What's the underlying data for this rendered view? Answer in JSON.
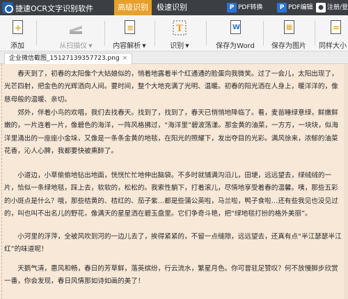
{
  "titlebar": {
    "app_title": "捷速OCR文字识别软件",
    "tabs": [
      {
        "label": "高级识别",
        "active": true
      },
      {
        "label": "极速识别",
        "active": false
      }
    ],
    "pdf_convert": "PDF转换",
    "pdf_edit": "PDF编辑",
    "user": "注册/登录"
  },
  "toolbar": {
    "add": "添加",
    "scan": "从扫描仪",
    "parse": "内容解析",
    "recognize": "识别",
    "save_word": "保存为Word",
    "save_image": "保存为图片",
    "more": "同样大小"
  },
  "doc_tab": {
    "filename": "企业微信截图_15127139357723.png",
    "close": "×"
  },
  "content": {
    "paragraphs": [
      "春天到了，初春的太阳像个大姑娘似的，悄着地露着半个红通通的脸蛋向我微笑。过了一会儿，太阳出现了，光芒四射，把金色的光辉洒向人间。要时间，整个大地充满了光明、温暖。初春的阳光洒在人身上，暖洋洋的，像慈母般的温暖、亲切。",
      "郊外，伴着小鸟的欢唱，我们去找春天。找到了，找到了，春天已悄悄地降临了。看，麦苗睡绿意绿，鲜嫩鲜嫩的，一片连着一片，像碧色的海洋，一阵风格拂过，“海洋里”碧波荡漾。那金黄的油菜，一方方，一块块，似海洋里涌出的一座座小金垛，又像是一条条金黄的地毯，在阳光的照耀下，发出夺目的光彩。满风徐来，浓郁的油菜花香，沁人心脾，我都要快被熏醉了。",
      "小道边，小草偷偷地钻出地面，恍恍忙忙地伸出脑袋。不多时就铺满沟沿儿，田埂，远远望去，绿绒绒的一片，恰似一条绿地毯，踩上去，软软的，松松的。我索性躺下，打着滚儿，尽情地享受着春的温馨。咦，那些五彩的小斑点是什么？哦，那些桔黄的、桔红的、茄子紫…都是些蒲公英啦，马兰啦，鸭子食啦…还有些我见也没见过的，叫也叫不出名儿的野花，像满天的星星洒在碧玉盘里。它们争奇斗艳，把“绿地毯打扮的格外美丽”。",
      "小河里的浮萍，全被风吹到河的一边儿去了，挨得紧紧的，不留一点缝隙，远远望去，还真有点“半江瑟瑟半江红”的味道呢！",
      "天鹅气清，惠风和畅，春日的芳草鲜，落英缤纷，行云流水，繁星月色。你可曾驻足赞叹？何不放慢脚步欣赏一番，你会发现，春日风情那如诗如画的美了！"
    ]
  }
}
